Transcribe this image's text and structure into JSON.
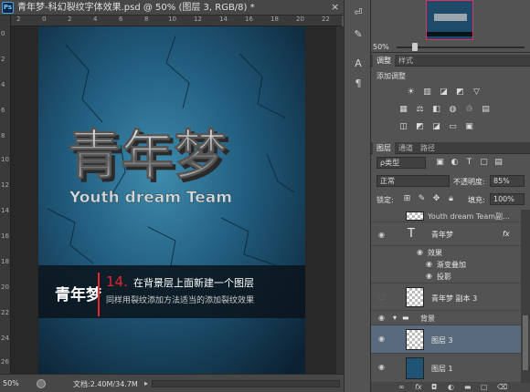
{
  "app": {
    "logo": "Ps"
  },
  "document": {
    "title": "青年梦-科幻裂纹字体效果.psd @ 50% (图层 3, RGB/8) *",
    "close": "×"
  },
  "ruler": {
    "h": [
      "2",
      "0",
      "2",
      "4",
      "6",
      "8",
      "10",
      "12",
      "14",
      "16",
      "18",
      "20",
      "22"
    ],
    "v": [
      "0",
      "2",
      "4",
      "6",
      "8",
      "10",
      "12",
      "14",
      "16",
      "18",
      "20",
      "22",
      "24",
      "26"
    ]
  },
  "poster": {
    "title": "青年梦",
    "subtitle": "Youth dream Team",
    "step_number": "14.",
    "step_text": "在背景层上面新建一个图层",
    "step_desc": "同样用裂纹添加方法适当的添加裂纹效果",
    "logo": "青年梦"
  },
  "status": {
    "zoom": "50%",
    "doc_size": "文档:2.40M/34.7M",
    "arrow": "▸"
  },
  "navigator": {
    "zoom": "50%"
  },
  "adjust_tabs": [
    "调整",
    "样式"
  ],
  "adjust": {
    "label": "添加调整"
  },
  "layers_tabs": [
    "图层",
    "通道",
    "路径"
  ],
  "layers": {
    "kind_filter": "ρ类型",
    "blend_mode": "正常",
    "opacity_label": "不透明度:",
    "opacity_value": "85%",
    "lock_label": "锁定:",
    "fill_label": "填充:",
    "fill_value": "100%",
    "items": [
      {
        "name": "Youth dream Team副...",
        "kind": "text"
      },
      {
        "name": "青年梦",
        "kind": "text",
        "fx": "fx"
      },
      {
        "name": "效果",
        "kind": "fx-group"
      },
      {
        "name": "渐变叠加",
        "kind": "fx"
      },
      {
        "name": "投影",
        "kind": "fx"
      },
      {
        "name": "青年梦 副本 3",
        "kind": "pixel"
      },
      {
        "name": "背景",
        "kind": "group"
      },
      {
        "name": "图层 3",
        "kind": "pixel",
        "selected": true
      },
      {
        "name": "图层 1",
        "kind": "pixel"
      }
    ]
  },
  "colors": {
    "accent_red": "#e8252c",
    "selection": "#596a7c"
  }
}
